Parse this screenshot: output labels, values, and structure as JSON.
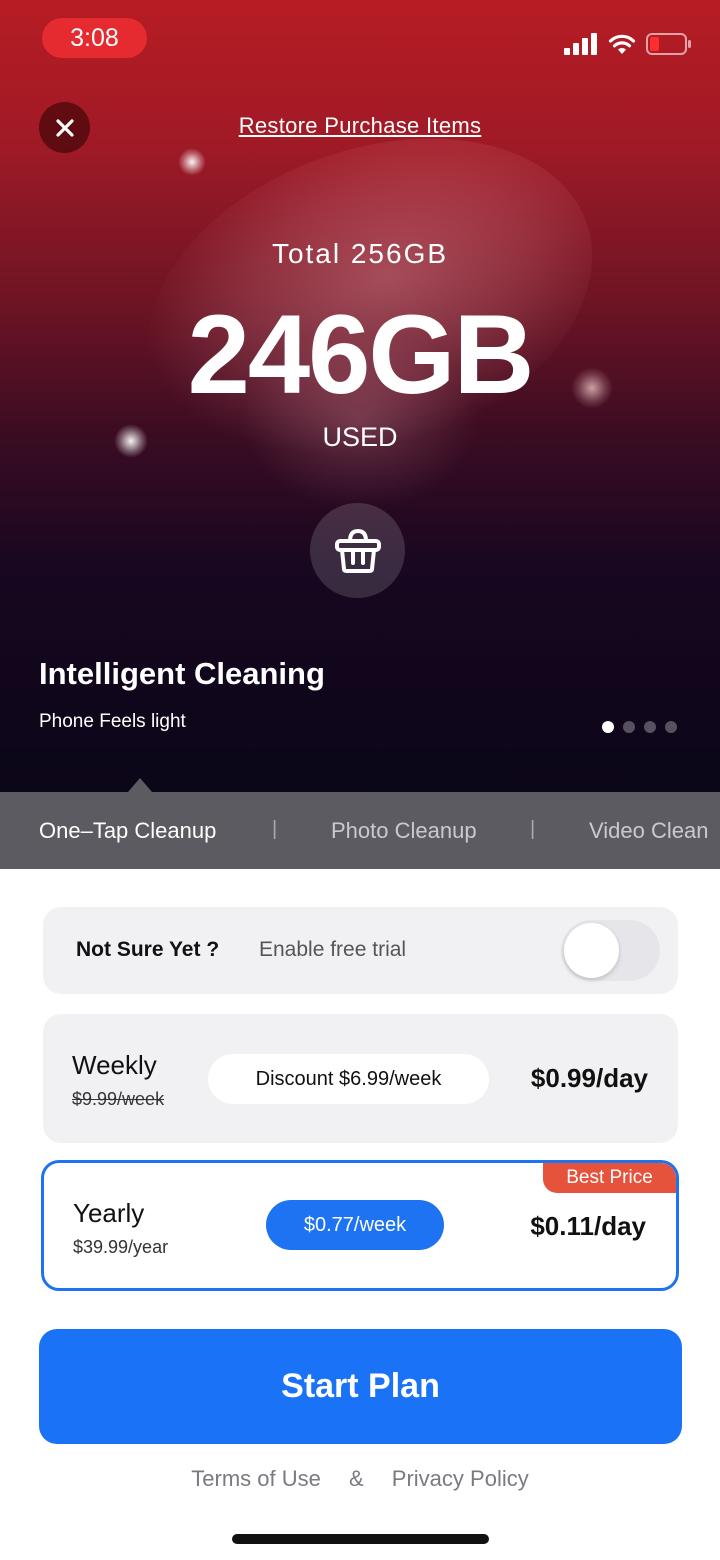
{
  "status_bar": {
    "time": "3:08"
  },
  "header": {
    "restore_label": "Restore Purchase Items"
  },
  "hero": {
    "total_label": "Total 256GB",
    "used_value": "246GB",
    "used_label": "USED",
    "feature_title": "Intelligent Cleaning",
    "feature_subtitle": "Phone Feels light",
    "page_count": 4,
    "active_page": 1
  },
  "tabs": [
    {
      "label": "One–Tap Cleanup",
      "active": true
    },
    {
      "label": "Photo Cleanup",
      "active": false
    },
    {
      "label": "Video Clean",
      "active": false
    }
  ],
  "tab_separator": "|",
  "trial": {
    "question": "Not Sure Yet ?",
    "enable_label": "Enable free trial",
    "enabled": false
  },
  "plans": {
    "weekly": {
      "name": "Weekly",
      "old_price": "$9.99/week",
      "discount": "Discount $6.99/week",
      "per_day": "$0.99/day"
    },
    "yearly": {
      "name": "Yearly",
      "price": "$39.99/year",
      "per_week": "$0.77/week",
      "per_day": "$0.11/day",
      "badge": "Best Price",
      "selected": true
    }
  },
  "cta": {
    "label": "Start Plan"
  },
  "footer": {
    "terms": "Terms of Use",
    "amp": "&",
    "privacy": "Privacy Policy"
  },
  "colors": {
    "accent": "#1a73f7",
    "badge": "#e5533c",
    "time_pill": "#e52b2f"
  }
}
